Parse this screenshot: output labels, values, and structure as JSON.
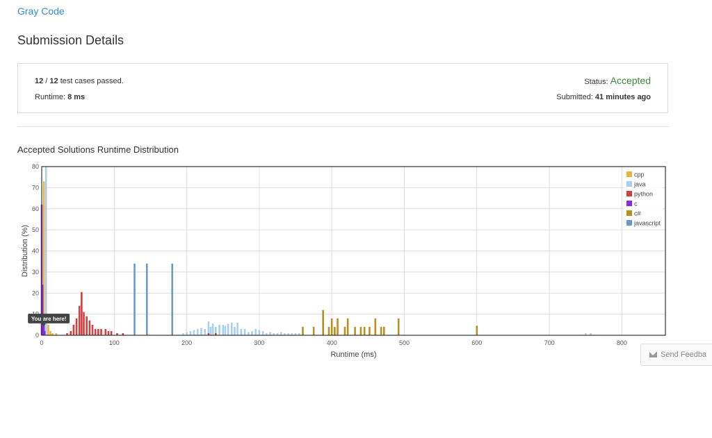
{
  "problem": {
    "title": "Gray Code"
  },
  "page": {
    "title": "Submission Details"
  },
  "result": {
    "passed": "12",
    "total": "12",
    "separator": " / ",
    "cases_text": " test cases passed.",
    "runtime_label": "Runtime: ",
    "runtime_value": "8 ms",
    "status_label": "Status: ",
    "status_value": "Accepted",
    "submitted_label": "Submitted: ",
    "submitted_value": "41 minutes ago"
  },
  "distribution": {
    "title": "Accepted Solutions Runtime Distribution"
  },
  "feedback": {
    "label": "Send Feedba",
    "icon": "mail-icon"
  },
  "colors": {
    "cpp": "#e8b33c",
    "java": "#a9cfee",
    "python": "#d04040",
    "c": "#8a2be2",
    "csharp": "#b8901e",
    "javascript": "#6b9ac4",
    "link": "#2a8fd0",
    "accepted": "#3c8a3c"
  },
  "chart_data": {
    "type": "bar",
    "xlabel": "Runtime (ms)",
    "ylabel": "Distribution (%)",
    "xlim": [
      0,
      860
    ],
    "ylim": [
      0,
      80
    ],
    "xticks": [
      0,
      100,
      200,
      300,
      400,
      500,
      600,
      700,
      800
    ],
    "yticks": [
      0,
      10,
      20,
      30,
      40,
      50,
      60,
      70,
      80
    ],
    "grid": true,
    "legend_position": "top-right",
    "marker": {
      "label": "You are here!",
      "x": 3,
      "y": 5
    },
    "series": [
      {
        "name": "cpp",
        "color": "#e8b33c",
        "points": [
          [
            3,
            73
          ],
          [
            6,
            11
          ],
          [
            9,
            5
          ],
          [
            12,
            2
          ],
          [
            15,
            1
          ],
          [
            20,
            1
          ]
        ]
      },
      {
        "name": "java",
        "color": "#a9cfee",
        "points": [
          [
            6,
            80
          ],
          [
            195,
            1
          ],
          [
            200,
            1.5
          ],
          [
            205,
            2
          ],
          [
            210,
            2.5
          ],
          [
            215,
            3
          ],
          [
            220,
            3.5
          ],
          [
            225,
            3
          ],
          [
            230,
            6.5
          ],
          [
            233,
            4
          ],
          [
            236,
            5.5
          ],
          [
            240,
            4
          ],
          [
            245,
            5
          ],
          [
            250,
            5
          ],
          [
            253,
            4.5
          ],
          [
            257,
            5.5
          ],
          [
            262,
            6
          ],
          [
            266,
            4
          ],
          [
            270,
            6
          ],
          [
            275,
            3
          ],
          [
            280,
            3
          ],
          [
            285,
            1.5
          ],
          [
            290,
            2
          ],
          [
            295,
            3
          ],
          [
            300,
            2.5
          ],
          [
            305,
            2
          ],
          [
            310,
            1
          ],
          [
            315,
            1.5
          ],
          [
            320,
            1
          ],
          [
            325,
            1
          ],
          [
            330,
            1.5
          ],
          [
            335,
            1
          ],
          [
            340,
            1
          ],
          [
            345,
            1
          ],
          [
            350,
            1
          ],
          [
            355,
            1
          ],
          [
            360,
            1
          ],
          [
            750,
            1
          ],
          [
            757,
            1
          ]
        ]
      },
      {
        "name": "python",
        "color": "#d04040",
        "points": [
          [
            35,
            1
          ],
          [
            40,
            2
          ],
          [
            44,
            5
          ],
          [
            48,
            8
          ],
          [
            52,
            14
          ],
          [
            55,
            20.5
          ],
          [
            58,
            11
          ],
          [
            62,
            9
          ],
          [
            66,
            7
          ],
          [
            70,
            5
          ],
          [
            74,
            3
          ],
          [
            78,
            3
          ],
          [
            82,
            3
          ],
          [
            88,
            3
          ],
          [
            92,
            2
          ],
          [
            96,
            2
          ],
          [
            104,
            1
          ],
          [
            112,
            1
          ],
          [
            230,
            1
          ],
          [
            240,
            1
          ]
        ]
      },
      {
        "name": "c",
        "color": "#8a2be2",
        "points": [
          [
            0,
            62
          ],
          [
            1,
            24
          ],
          [
            2,
            10
          ],
          [
            3,
            5
          ],
          [
            4,
            2
          ]
        ]
      },
      {
        "name": "c#",
        "color": "#b8901e",
        "points": [
          [
            360,
            4
          ],
          [
            375,
            4
          ],
          [
            388,
            12
          ],
          [
            396,
            4
          ],
          [
            400,
            8
          ],
          [
            404,
            4
          ],
          [
            408,
            8
          ],
          [
            418,
            4
          ],
          [
            422,
            8
          ],
          [
            432,
            4
          ],
          [
            440,
            4
          ],
          [
            445,
            4
          ],
          [
            452,
            4
          ],
          [
            460,
            8
          ],
          [
            468,
            4
          ],
          [
            472,
            4
          ],
          [
            492,
            8
          ],
          [
            600,
            4.5
          ]
        ]
      },
      {
        "name": "javascript",
        "color": "#6b9ac4",
        "points": [
          [
            128,
            34
          ],
          [
            145,
            34
          ],
          [
            180,
            34
          ]
        ]
      }
    ]
  }
}
